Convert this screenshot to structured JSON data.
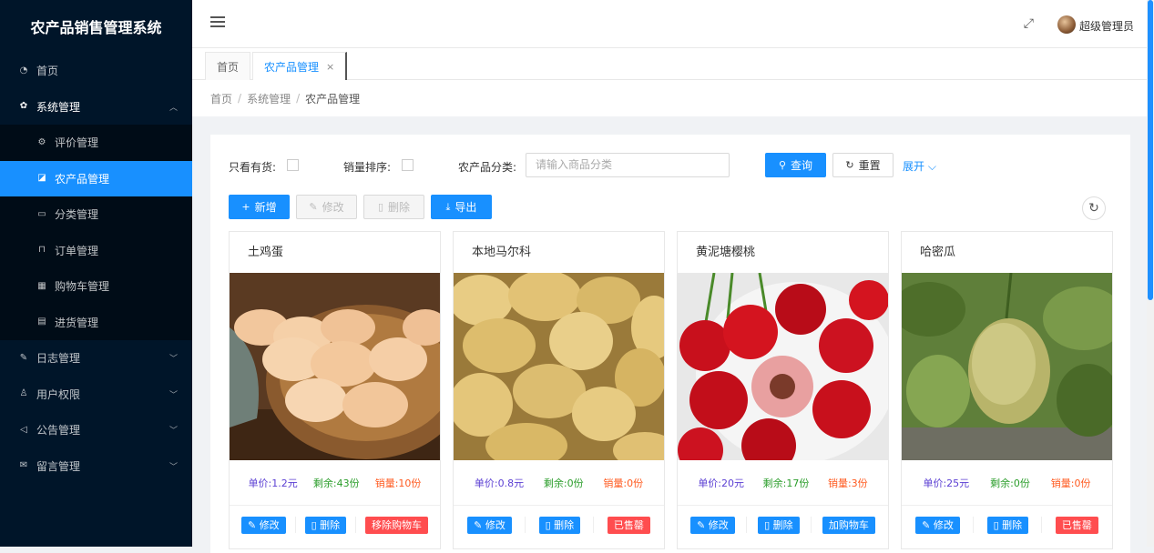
{
  "app": {
    "title": "农产品销售管理系统"
  },
  "sidebar": {
    "items": [
      {
        "label": "首页",
        "icon": "dashboard-icon"
      },
      {
        "label": "系统管理",
        "icon": "gear-icon",
        "open": true
      },
      {
        "label": "评价管理",
        "icon": "settings-icon"
      },
      {
        "label": "农产品管理",
        "icon": "product-icon",
        "active": true
      },
      {
        "label": "分类管理",
        "icon": "category-icon"
      },
      {
        "label": "订单管理",
        "icon": "lock-icon"
      },
      {
        "label": "购物车管理",
        "icon": "table-icon"
      },
      {
        "label": "进货管理",
        "icon": "file-icon"
      },
      {
        "label": "日志管理",
        "icon": "edit-icon"
      },
      {
        "label": "用户权限",
        "icon": "user-icon"
      },
      {
        "label": "公告管理",
        "icon": "sound-icon"
      },
      {
        "label": "留言管理",
        "icon": "mail-icon"
      }
    ]
  },
  "header": {
    "username": "超级管理员"
  },
  "tabs": [
    {
      "label": "首页"
    },
    {
      "label": "农产品管理",
      "close": "×"
    }
  ],
  "breadcrumb": [
    "首页",
    "系统管理",
    "农产品管理"
  ],
  "breadcrumb_sep": "/",
  "filters": {
    "in_stock_label": "只看有货:",
    "sales_sort_label": "销量排序:",
    "category_label": "农产品分类:",
    "category_placeholder": "请输入商品分类",
    "query_label": "查询",
    "reset_label": "重置",
    "expand_label": "展开"
  },
  "toolbar": {
    "add_label": "新增",
    "edit_label": "修改",
    "delete_label": "删除",
    "export_label": "导出"
  },
  "products": [
    {
      "name": "土鸡蛋",
      "price": "单价:1.2元",
      "left": "剩余:43份",
      "sold": "销量:10份",
      "edit": "修改",
      "del": "删除",
      "action": "移除购物车",
      "action_color": "#ff4d4f"
    },
    {
      "name": "本地马尔科",
      "price": "单价:0.8元",
      "left": "剩余:0份",
      "sold": "销量:0份",
      "edit": "修改",
      "del": "删除",
      "action": "已售罄",
      "action_color": "#ff4d4f"
    },
    {
      "name": "黄泥塘樱桃",
      "price": "单价:20元",
      "left": "剩余:17份",
      "sold": "销量:3份",
      "edit": "修改",
      "del": "删除",
      "action": "加购物车",
      "action_color": "#1890ff"
    },
    {
      "name": "哈密瓜",
      "price": "单价:25元",
      "left": "剩余:0份",
      "sold": "销量:0份",
      "edit": "修改",
      "del": "删除",
      "action": "已售罄",
      "action_color": "#ff4d4f"
    }
  ],
  "colors": {
    "sidebar_bg": "#001529",
    "accent": "#1890ff",
    "danger": "#ff4d4f"
  }
}
